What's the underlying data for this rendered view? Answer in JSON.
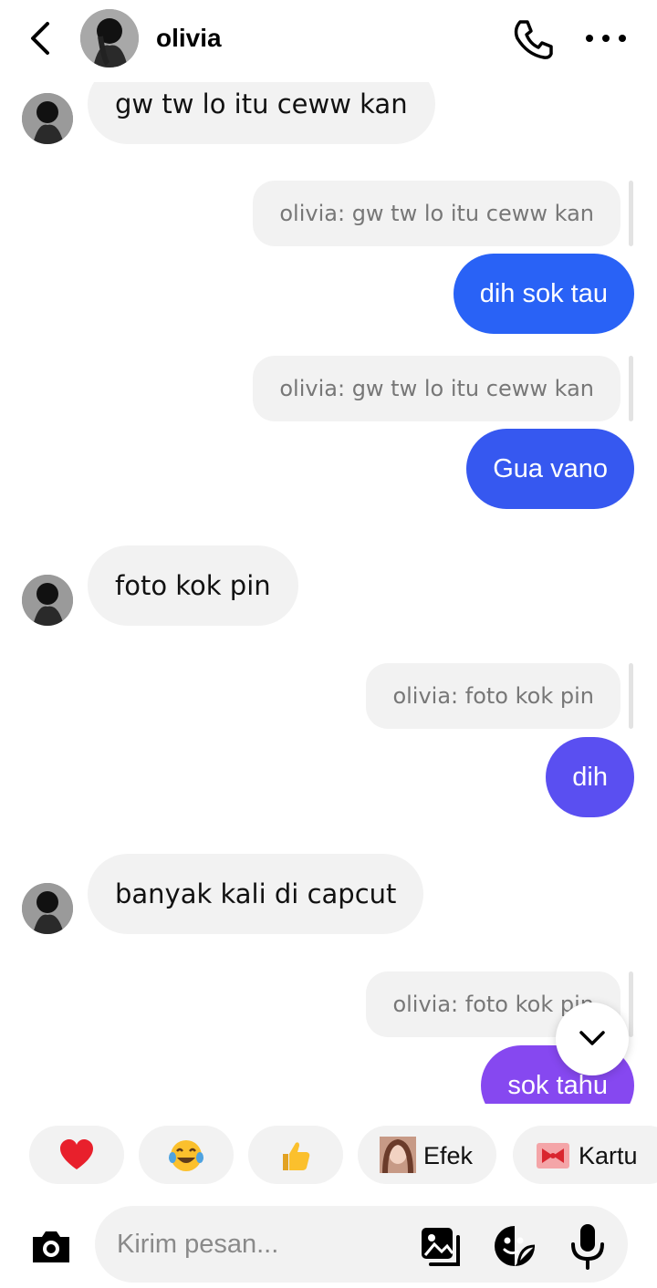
{
  "header": {
    "name": "olivia"
  },
  "messages": [
    {
      "text": "gw tw lo itu ceww kan"
    },
    {
      "quote": "olivia: gw tw lo itu ceww kan",
      "text": "dih sok tau",
      "color": "#2962f6"
    },
    {
      "quote": "olivia: gw tw lo itu ceww kan",
      "text": "Gua vano",
      "color": "#3658f0"
    },
    {
      "text": "foto kok pin"
    },
    {
      "quote": "olivia: foto kok pin",
      "text": "dih",
      "color": "#5a4ff1"
    },
    {
      "text": "banyak kali di capcut"
    },
    {
      "quote": "olivia: foto kok pin",
      "text": "sok tahu",
      "color": "#8648f0"
    }
  ],
  "reactions": {
    "heart": "heart",
    "laugh": "tears-of-joy",
    "thumbs": "thumbs-up",
    "effects_label": "Efek",
    "card_label": "Kartu"
  },
  "composer": {
    "placeholder": "Kirim pesan..."
  }
}
